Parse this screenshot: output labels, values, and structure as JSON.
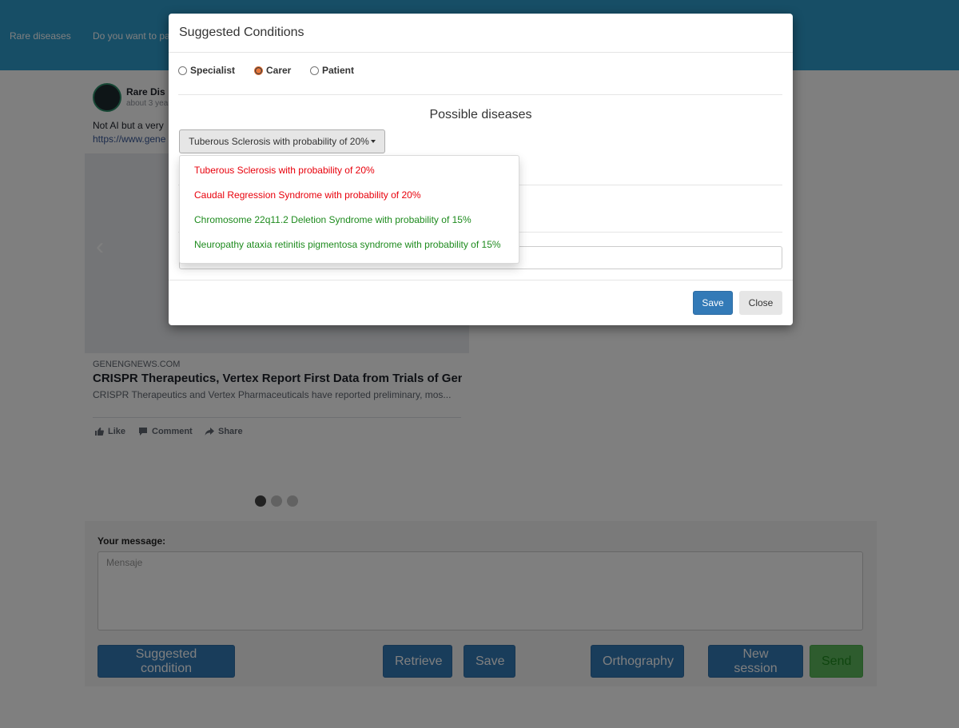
{
  "nav": {
    "items": [
      "Rare diseases",
      "Do you want to pa"
    ]
  },
  "post": {
    "author": "Rare Dis",
    "time": "about 3 yea",
    "text": "Not AI but a very",
    "link": "https://www.gene",
    "carousel_prev": "‹",
    "domain": "GENENGNEWS.COM",
    "headline": "CRISPR Therapeutics, Vertex Report First Data from Trials of Gene...",
    "description": "CRISPR Therapeutics and Vertex Pharmaceuticals have reported preliminary, mos...",
    "actions": {
      "like": "Like",
      "comment": "Comment",
      "share": "Share"
    }
  },
  "carousel": {
    "dots": 3,
    "active_index": 0
  },
  "message": {
    "label": "Your message:",
    "placeholder": "Mensaje",
    "buttons": {
      "suggested": "Suggested condition",
      "retrieve": "Retrieve",
      "save": "Save",
      "orthography": "Orthography",
      "new_session": "New session",
      "send": "Send"
    }
  },
  "modal": {
    "title": "Suggested Conditions",
    "roles": [
      "Specialist",
      "Carer",
      "Patient"
    ],
    "selected_role": "Carer",
    "heading": "Possible diseases",
    "dropdown_selected": "Tuberous Sclerosis with probability of 20%",
    "options": [
      {
        "label": "Tuberous Sclerosis with probability of 20%",
        "color": "#e8000b"
      },
      {
        "label": "Caudal Regression Syndrome with probability of 20%",
        "color": "#e8000b"
      },
      {
        "label": "Chromosome 22q11.2 Deletion Syndrome with probability of 15%",
        "color": "#1e8b1e"
      },
      {
        "label": "Neuropathy ataxia retinitis pigmentosa syndrome with probability of 15%",
        "color": "#1e8b1e"
      }
    ],
    "save": "Save",
    "close": "Close"
  },
  "colors": {
    "topbar": "#2e9ccd",
    "primary": "#337ab7",
    "success": "#5cb85c",
    "high_probability": "#e8000b",
    "lower_probability": "#1e8b1e"
  }
}
